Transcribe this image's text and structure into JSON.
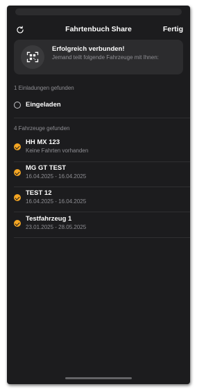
{
  "nav": {
    "refresh_icon": "refresh-icon",
    "title": "Fahrtenbuch Share",
    "done_label": "Fertig"
  },
  "banner": {
    "icon": "qr-scan-icon",
    "title": "Erfolgreich verbunden!",
    "subtitle": "Jemand teilt folgende Fahrzeuge mit Ihnen:"
  },
  "invitations": {
    "header": "1 Einladungen gefunden",
    "items": [
      {
        "title": "Eingeladen",
        "checked": false
      }
    ]
  },
  "vehicles": {
    "header": "4 Fahrzeuge gefunden",
    "items": [
      {
        "title": "HH MX 123",
        "subtitle": "Keine Fahrten vorhanden",
        "checked": true
      },
      {
        "title": "MG GT TEST",
        "subtitle": "16.04.2025 - 16.04.2025",
        "checked": true
      },
      {
        "title": "TEST 12",
        "subtitle": "16.04.2025 - 16.04.2025",
        "checked": true
      },
      {
        "title": "Testfahrzeug 1",
        "subtitle": "23.01.2025 - 28.05.2025",
        "checked": true
      }
    ]
  },
  "colors": {
    "background": "#1c1c1e",
    "card": "#2c2c2e",
    "accent": "#f5a623",
    "secondary_text": "#8e8e93"
  }
}
